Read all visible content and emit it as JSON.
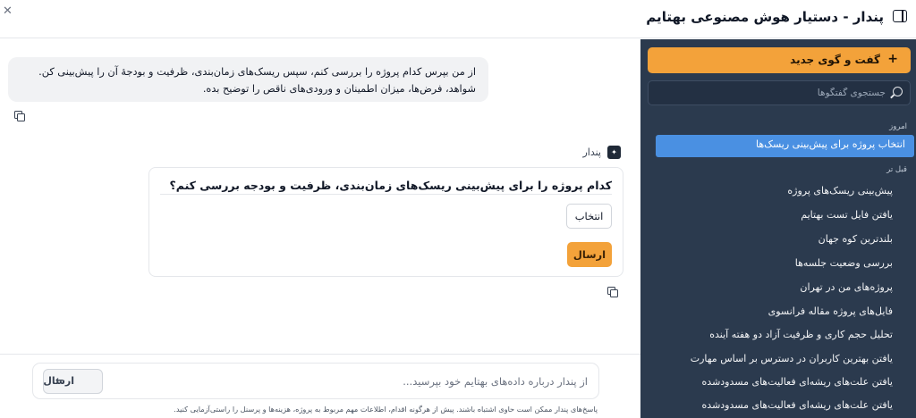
{
  "window": {
    "title": "پندار - دستیار هوش مصنوعی بهتایم",
    "close_icon": "close-icon",
    "sidebar_toggle_icon": "sidebar-toggle-icon"
  },
  "conversation": {
    "user_message": "از من بپرس کدام پروژه را بررسی کنم، سپس ریسک‌های زمان‌بندی، ظرفیت و بودجهٔ آن را پیش‌بینی کن. شواهد، فرض‌ها، میزان اطمینان و ورودی‌های ناقص را توضیح بده.",
    "assistant_name": "پندار",
    "card": {
      "question": "کدام پروژه را برای پیش‌بینی ریسک‌های زمان‌بندی، ظرفیت و بودجه بررسی کنم؟",
      "select_value": "انتخاب",
      "send_label": "ارسال"
    }
  },
  "composer": {
    "placeholder": "از پندار درباره داده‌های بهتایم خود بپرسید...",
    "send_label": "ارسال",
    "disclaimer": "پاسخ‌های پندار ممکن است حاوی اشتباه باشند. پیش از هرگونه اقدام، اطلاعات مهم مربوط به پروژه، هزینه‌ها و پرسنل را راستی‌آزمایی کنید."
  },
  "sidebar": {
    "new_chat_label": "گفت و گوی جدید",
    "search_placeholder": "جستجوی گفتگوها",
    "today_label": "امروز",
    "active_item": "انتخاب پروژه برای پیش‌بینی ریسک‌ها",
    "older_label": "قبل تر",
    "items": [
      "پیش‌بینی ریسک‌های پروژه",
      "یافتن فایل تست بهتایم",
      "بلندترین کوه جهان",
      "بررسی وضعیت جلسه‌ها",
      "پروژه‌های من در تهران",
      "فایل‌های پروژه مقاله فرانسوی",
      "تحلیل حجم کاری و ظرفیت آزاد دو هفته آینده",
      "یافتن بهترین کاربران در دسترس بر اساس مهارت",
      "یافتن علت‌های ریشه‌ای فعالیت‌های مسدودشده",
      "یافتن علت‌های ریشه‌ای فعالیت‌های مسدودشده"
    ]
  },
  "colors": {
    "accent": "#f3a23a",
    "sidebar_bg": "#2b3a4e",
    "active_item": "#4a90e2"
  }
}
